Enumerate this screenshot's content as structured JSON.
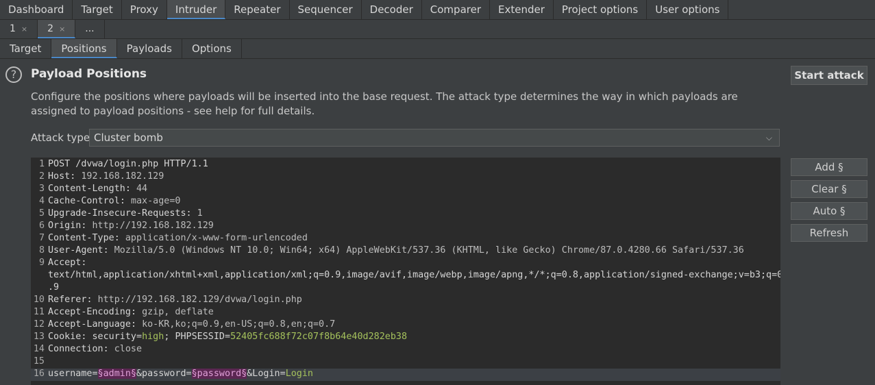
{
  "top_tabs": [
    "Dashboard",
    "Target",
    "Proxy",
    "Intruder",
    "Repeater",
    "Sequencer",
    "Decoder",
    "Comparer",
    "Extender",
    "Project options",
    "User options"
  ],
  "num_tabs": [
    {
      "label": "1",
      "close": "×"
    },
    {
      "label": "2",
      "close": "×"
    },
    {
      "label": "...",
      "close": ""
    }
  ],
  "sub_tabs": [
    "Target",
    "Positions",
    "Payloads",
    "Options"
  ],
  "help_glyph": "?",
  "title": "Payload Positions",
  "description": "Configure the positions where payloads will be inserted into the base request. The attack type determines the way in which payloads are assigned to payload positions - see help for full details.",
  "attack_type_label": "Attack type:",
  "attack_type_value": "Cluster bomb",
  "buttons": {
    "start": "Start attack",
    "add": "Add §",
    "clear": "Clear §",
    "auto": "Auto §",
    "refresh": "Refresh"
  },
  "request_lines": [
    {
      "n": "1",
      "text": "POST /dvwa/login.php HTTP/1.1"
    },
    {
      "n": "2",
      "key": "Host",
      "val": "192.168.182.129"
    },
    {
      "n": "3",
      "key": "Content-Length",
      "val": "44"
    },
    {
      "n": "4",
      "key": "Cache-Control",
      "val": "max-age=0"
    },
    {
      "n": "5",
      "key": "Upgrade-Insecure-Requests",
      "val": "1"
    },
    {
      "n": "6",
      "key": "Origin",
      "val": "http://192.168.182.129"
    },
    {
      "n": "7",
      "key": "Content-Type",
      "val": "application/x-www-form-urlencoded"
    },
    {
      "n": "8",
      "key": "User-Agent",
      "val": "Mozilla/5.0 (Windows NT 10.0; Win64; x64) AppleWebKit/537.36 (KHTML, like Gecko) Chrome/87.0.4280.66 Safari/537.36"
    },
    {
      "n": "9",
      "key": "Accept",
      "val": ""
    },
    {
      "n": "",
      "text": "text/html,application/xhtml+xml,application/xml;q=0.9,image/avif,image/webp,image/apng,*/*;q=0.8,application/signed-exchange;v=b3;q=0"
    },
    {
      "n": "",
      "text": ".9"
    },
    {
      "n": "10",
      "key": "Referer",
      "val": "http://192.168.182.129/dvwa/login.php"
    },
    {
      "n": "11",
      "key": "Accept-Encoding",
      "val": "gzip, deflate"
    },
    {
      "n": "12",
      "key": "Accept-Language",
      "val": "ko-KR,ko;q=0.9,en-US;q=0.8,en;q=0.7"
    },
    {
      "n": "13",
      "cookie": true
    },
    {
      "n": "14",
      "key": "Connection",
      "val": "close"
    },
    {
      "n": "15",
      "text": ""
    },
    {
      "n": "16",
      "body": true
    }
  ],
  "cookie": {
    "key": "Cookie",
    "p1": "security",
    "v1": "high",
    "p2": "PHPSESSID",
    "v2": "52405fc688f72c07f8b64e40d282eb38"
  },
  "body": {
    "a": "username=",
    "m1": "§admin§",
    "b": "&password=",
    "m2": "§password§",
    "c": "&Login=",
    "d": "Login"
  },
  "colors": {
    "accent": "#4a88c7",
    "marker_bg": "#5b2752",
    "value_green": "#a5c25c"
  }
}
